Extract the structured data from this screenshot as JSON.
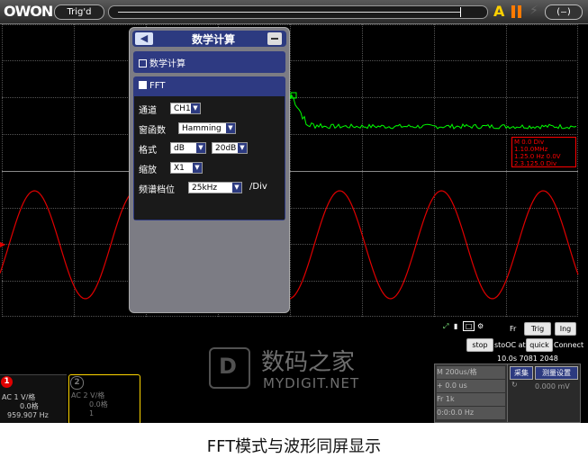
{
  "topbar": {
    "logo": "OWON",
    "trig_label": "Trig'd",
    "acq_mode": "A",
    "window_button": "(–)"
  },
  "fft_menu": {
    "title": "数学计算",
    "back_icon": "back-arrow-icon",
    "math_section": "数学计算",
    "fft_section": "FFT",
    "rows": [
      {
        "label": "通道",
        "value": "CH1"
      },
      {
        "label": "窗函数",
        "value": "Hamming"
      },
      {
        "label": "格式",
        "value": "dB",
        "value2": "20dB"
      },
      {
        "label": "缩放",
        "value": "X1"
      },
      {
        "label": "频谱档位",
        "value": "25kHz",
        "unit": "/Div"
      }
    ]
  },
  "fft_readout": {
    "lines": [
      "M 0.0 Div",
      "1.10.0MHz",
      "1.25.0 Hz 0.0V",
      "2.3.125.0 Div"
    ],
    "color": "#ff0000"
  },
  "bottom": {
    "ctrl_row1": [
      "Fr",
      "Trig",
      "Ing"
    ],
    "ctrl_row2": [
      "stop",
      "stoOC at",
      "quick",
      "Connect"
    ],
    "ctrl_row3": "10.0s 7081   2048",
    "ch1": {
      "label": "1",
      "lines": [
        "AC   1 V/格",
        "0.0格",
        "959.907 Hz"
      ]
    },
    "ch2": {
      "label": "2",
      "lines": [
        "AC   2 V/格",
        "0.0格",
        "1"
      ]
    },
    "meas": [
      "M   200us/格",
      "+   0.0 us",
      "Fr   1k",
      "0:0:0.0 Hz"
    ],
    "right_btns": [
      "采集",
      "测量设置"
    ],
    "right_val": "0.000 mV"
  },
  "watermark": {
    "logo_glyph": "D",
    "cn": "数码之家",
    "en": "MYDIGIT.NET"
  },
  "caption": "FFT模式与波形同屏显示",
  "colors": {
    "ch1_wave": "#e00000",
    "fft_trace": "#00ff00",
    "menu_header": "#2c3a80",
    "ch2_border": "#ffd700"
  }
}
